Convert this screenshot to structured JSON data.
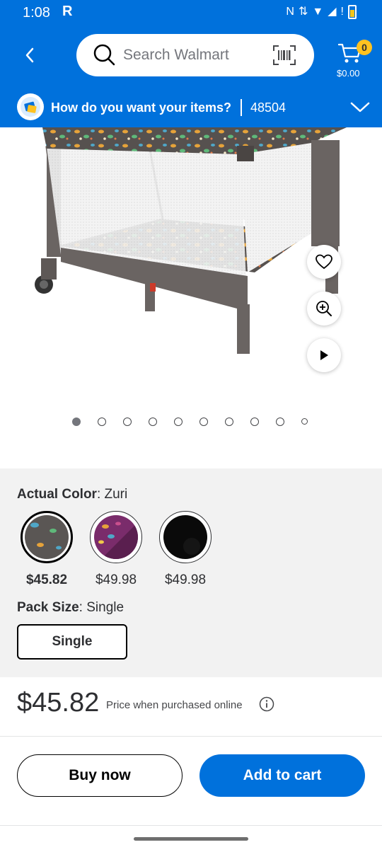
{
  "status_bar": {
    "time": "1:08",
    "app_badge": "R",
    "icons": [
      "nfc-icon",
      "data-arrows-icon",
      "wifi-icon",
      "signal-icon",
      "battery-icon"
    ]
  },
  "header": {
    "search": {
      "placeholder": "Search Walmart"
    },
    "cart": {
      "badge_count": "0",
      "total": "$0.00"
    },
    "fulfillment": {
      "prompt": "How do you want your items?",
      "zip": "48504"
    },
    "colors": {
      "brand": "#0071dc",
      "badge": "#ffc220"
    }
  },
  "product_image": {
    "carousel": {
      "count": 10,
      "active_index": 0
    }
  },
  "variants": {
    "color": {
      "label": "Actual Color",
      "value": ": Zuri",
      "options": [
        {
          "name": "Zuri",
          "price": "$45.82",
          "selected": true,
          "color": "#5a5654"
        },
        {
          "name": "Purple",
          "price": "$49.98",
          "selected": false,
          "color": "#6b2a5e"
        },
        {
          "name": "Black",
          "price": "$49.98",
          "selected": false,
          "color": "#0a0a0a"
        }
      ]
    },
    "pack_size": {
      "label": "Pack Size",
      "value": ": Single",
      "option_label": "Single"
    }
  },
  "pricing": {
    "price": "$45.82",
    "note": "Price when purchased online"
  },
  "actions": {
    "buy_now": "Buy now",
    "add_to_cart": "Add to cart"
  }
}
